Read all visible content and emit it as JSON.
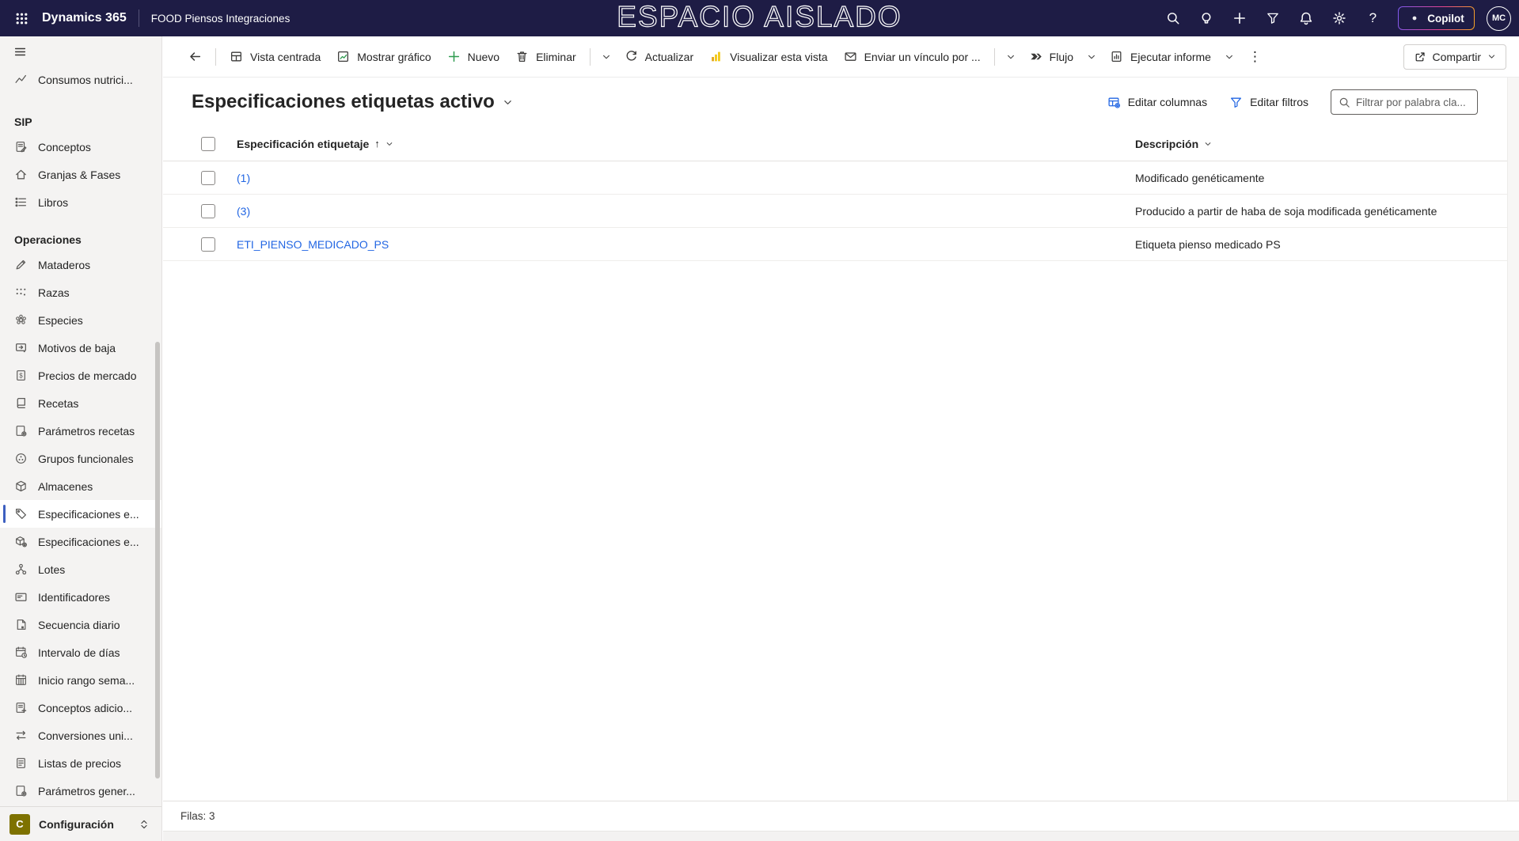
{
  "colors": {
    "topbar_bg": "#1E1C45",
    "accent_blue": "#2266E3",
    "link_blue": "#2266E3",
    "selected_bar_blue": "#3D5FC0",
    "new_green": "#2E9B4F",
    "powerbi_yellow": "#F2C811",
    "config_badge_olive": "#7E7200"
  },
  "topbar": {
    "brand": "Dynamics 365",
    "app_name": "FOOD Piensos Integraciones",
    "environment_title": "ESPACIO AISLADO",
    "icons": [
      "waffle-icon",
      "search-icon",
      "lightbulb-icon",
      "plus-icon",
      "filter-icon",
      "bell-icon",
      "gear-icon",
      "help-icon"
    ],
    "help_glyph": "?",
    "copilot_label": "Copilot",
    "avatar_initials": "MC"
  },
  "toolbar": {
    "back_icon": "arrow-left-icon",
    "items": [
      {
        "label": "Vista centrada",
        "icon": "grid-layout-icon"
      },
      {
        "label": "Mostrar gráfico",
        "icon": "chart-icon"
      },
      {
        "label": "Nuevo",
        "icon": "plus-icon"
      },
      {
        "label": "Eliminar",
        "icon": "trash-icon"
      },
      {
        "label": "Actualizar",
        "icon": "refresh-icon"
      },
      {
        "label": "Visualizar esta vista",
        "icon": "powerbi-icon"
      },
      {
        "label": "Enviar un vínculo por ...",
        "icon": "envelope-icon"
      },
      {
        "label": "Flujo",
        "icon": "flow-icon"
      },
      {
        "label": "Ejecutar informe",
        "icon": "report-icon"
      }
    ],
    "more_glyph": "⋮",
    "compartir": {
      "label": "Compartir",
      "icon": "share-icon"
    }
  },
  "view": {
    "title": "Especificaciones etiquetas activo",
    "actions": [
      {
        "label": "Editar columnas",
        "icon": "table-gear-icon"
      },
      {
        "label": "Editar filtros",
        "icon": "funnel-icon"
      }
    ],
    "filtro_placeholder": "Filtrar por palabra cla..."
  },
  "table": {
    "col_especificacion": "Especificación etiquetaje",
    "sort_arrow": "↑",
    "col_descripcion": "Descripción",
    "rows": [
      {
        "name": "(1)",
        "desc": "Modificado genéticamente"
      },
      {
        "name": "(3)",
        "desc": "Producido a partir de haba de soja modificada genéticamente"
      },
      {
        "name": "ETI_PIENSO_MEDICADO_PS",
        "desc": "Etiqueta pienso medicado PS"
      }
    ],
    "row_count_label": "Filas: 3"
  },
  "sidebar": {
    "top_item": {
      "label": "Consumos nutrici...",
      "icon": "line-chart-icon"
    },
    "sections": [
      {
        "title": "SIP",
        "items": [
          {
            "label": "Conceptos",
            "icon": "note-edit-icon"
          },
          {
            "label": "Granjas & Fases",
            "icon": "home-icon"
          },
          {
            "label": "Libros",
            "icon": "list-icon"
          }
        ]
      },
      {
        "title": "Operaciones",
        "items": [
          {
            "label": "Mataderos",
            "icon": "pen-icon"
          },
          {
            "label": "Razas",
            "icon": "dots-grid-icon"
          },
          {
            "label": "Especies",
            "icon": "flower-icon"
          },
          {
            "label": "Motivos de baja",
            "icon": "screen-icon"
          },
          {
            "label": "Precios de mercado",
            "icon": "document-dollar-icon"
          },
          {
            "label": "Recetas",
            "icon": "book-icon"
          },
          {
            "label": "Parámetros recetas",
            "icon": "document-gear-icon"
          },
          {
            "label": "Grupos funcionales",
            "icon": "circle-dots-icon"
          },
          {
            "label": "Almacenes",
            "icon": "cube-icon"
          },
          {
            "label": "Especificaciones e...",
            "icon": "tag-icon",
            "selected": true
          },
          {
            "label": "Especificaciones e...",
            "icon": "cube-gear-icon"
          },
          {
            "label": "Lotes",
            "icon": "branch-icon"
          },
          {
            "label": "Identificadores",
            "icon": "card-icon"
          },
          {
            "label": "Secuencia diario",
            "icon": "document-corner-icon"
          },
          {
            "label": "Intervalo de días",
            "icon": "calendar-clock-icon"
          },
          {
            "label": "Inicio rango sema...",
            "icon": "calendar-icon"
          },
          {
            "label": "Conceptos adicio...",
            "icon": "document-plus-icon"
          },
          {
            "label": "Conversiones uni...",
            "icon": "swap-arrows-icon"
          },
          {
            "label": "Listas de precios",
            "icon": "document-lines-icon"
          },
          {
            "label": "Parámetros gener...",
            "icon": "document-gear-icon"
          }
        ]
      }
    ],
    "footer": {
      "label": "Configuración",
      "initial": "C"
    }
  }
}
